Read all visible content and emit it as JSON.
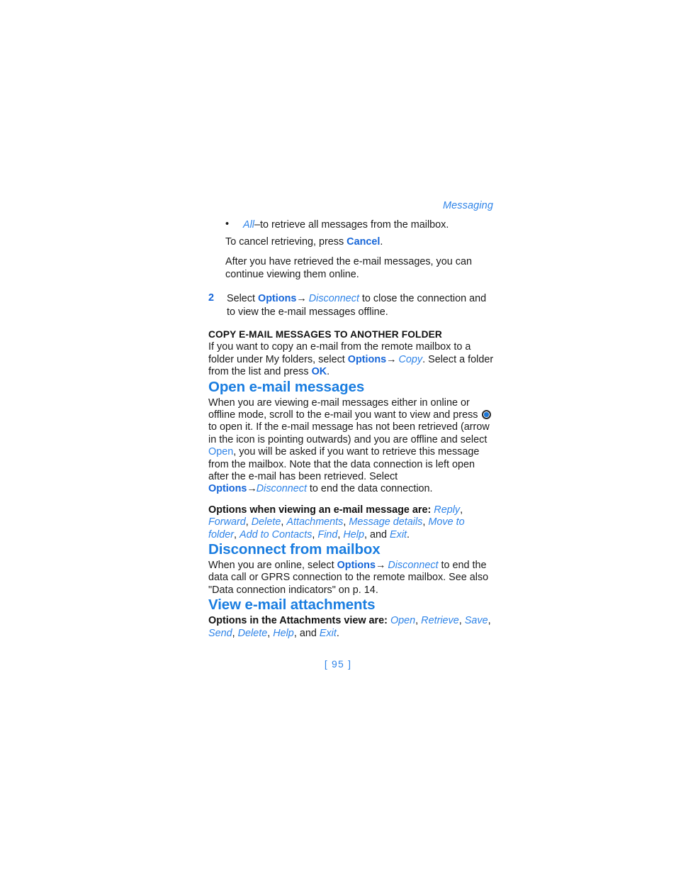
{
  "document": {
    "running_head": "Messaging",
    "folio": "[ 95 ]"
  },
  "colors": {
    "heading_blue": "#1a7de0",
    "bold_ui_blue": "#1565d8",
    "italic_ui_blue": "#2f84e8",
    "body_black": "#1a1a1a"
  },
  "bullet_list": {
    "marker": "•",
    "item_term": "All",
    "item_dash": "–",
    "item_text": "to retrieve all messages from the mailbox.",
    "sub_line_prefix": "To cancel retrieving, press ",
    "sub_line_key": "Cancel",
    "sub_line_suffix": "."
  },
  "after_paragraph": "After you have retrieved the e-mail messages, you can continue viewing them online.",
  "step": {
    "number": "2",
    "text_before": "Select ",
    "menu": "Options",
    "arrow": "→",
    "menu_item": "Disconnect",
    "text_after": " to close the connection and to view the e-mail messages offline."
  },
  "copy_subsection": {
    "heading": "COPY E-MAIL MESSAGES TO ANOTHER FOLDER",
    "text_1": "If you want to copy an e-mail from the remote mailbox to a folder under My folders, select ",
    "menu": "Options",
    "arrow": "→",
    "menu_item": "Copy",
    "text_2": ". Select a folder from the list and press ",
    "key": "OK",
    "text_3": "."
  },
  "open_section": {
    "heading": "Open e-mail messages",
    "p1_a": "When you are viewing e-mail messages either in online or offline mode, scroll to the e-mail you want to view and press ",
    "scroll_key_icon": "scroll-key-icon",
    "p1_b": " to open it. If the e-mail message has not been retrieved (arrow in the icon is pointing outwards) and you are offline and select ",
    "p1_open": "Open",
    "p1_c": ", you will be asked if you want to retrieve this message from the mailbox. Note that the data connection is left open after the e-mail has been retrieved. Select ",
    "p1_menu": "Options",
    "p1_arrow": "→",
    "p1_menu_item": "Disconnect",
    "p1_d": " to end the data connection.",
    "p2_lead": "Options when viewing an e-mail message are: ",
    "p2_items": [
      "Reply",
      "Forward",
      "Delete",
      "Attachments",
      "Message details",
      "Move to folder",
      "Add to Contacts",
      "Find",
      "Help"
    ],
    "p2_and": ", and ",
    "p2_last": "Exit",
    "p2_end": "."
  },
  "disconnect_section": {
    "heading": "Disconnect from mailbox",
    "p1_a": "When you are online, select ",
    "menu": "Options",
    "arrow": "→",
    "menu_item": "Disconnect",
    "p1_b": " to end the data call or GPRS connection to the remote mailbox. See also \"Data connection indicators\" on p. 14."
  },
  "attachments_section": {
    "heading": "View e-mail attachments",
    "lead": "Options in the Attachments view are: ",
    "items": [
      "Open",
      "Retrieve",
      "Save",
      "Send",
      "Delete",
      "Help"
    ],
    "and": ", and ",
    "last": "Exit",
    "end": "."
  }
}
